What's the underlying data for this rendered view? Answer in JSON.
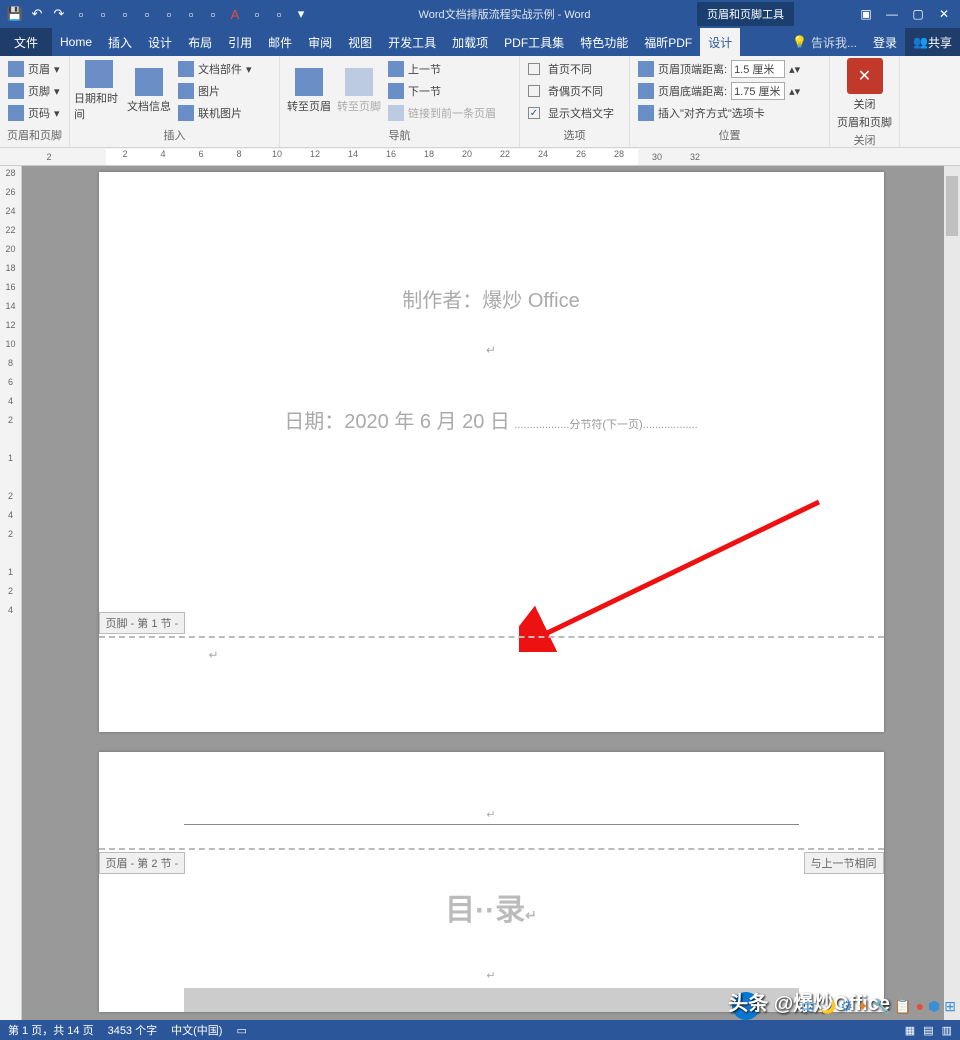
{
  "title": "Word文档排版流程实战示例 - Word",
  "context_tab": "页眉和页脚工具",
  "menu": {
    "file": "文件",
    "home": "Home",
    "insert": "插入",
    "design": "设计",
    "layout": "布局",
    "ref": "引用",
    "mail": "邮件",
    "review": "审阅",
    "view": "视图",
    "dev": "开发工具",
    "addin": "加载项",
    "pdf": "PDF工具集",
    "special": "特色功能",
    "foxit": "福昕PDF",
    "design2": "设计",
    "tell": "告诉我...",
    "login": "登录",
    "share": "共享"
  },
  "ribbon": {
    "header": "页眉",
    "footer": "页脚",
    "pagenum": "页码",
    "datetime": "日期和时间",
    "docinfo": "文档信息",
    "parts": "文档部件",
    "pic": "图片",
    "onlinepic": "联机图片",
    "goheader": "转至页眉",
    "gofooter": "转至页脚",
    "prev": "上一节",
    "next": "下一节",
    "linkprev": "链接到前一条页眉",
    "firstdiff": "首页不同",
    "oddeven": "奇偶页不同",
    "showdoc": "显示文档文字",
    "topdist": "页眉顶端距离:",
    "botdist": "页眉底端距离:",
    "aligntab": "插入\"对齐方式\"选项卡",
    "topval": "1.5 厘米",
    "botval": "1.75 厘米",
    "close": "关闭",
    "closehf": "页眉和页脚",
    "g1": "页眉和页脚",
    "g2": "插入",
    "g3": "导航",
    "g4": "选项",
    "g5": "位置",
    "g6": "关闭"
  },
  "doc": {
    "author": "制作者：爆炒 Office",
    "date": "日期：2020 年 6 月 20 日",
    "sectbreak": "分节符(下一页)",
    "footer1": "页脚 - 第 1 节 -",
    "header2": "页眉 - 第 2 节 -",
    "sameprev": "与上一节相同",
    "toc": "目··录"
  },
  "status": {
    "page": "第 1 页，共 14 页",
    "words": "3453 个字",
    "lang": "中文(中国)"
  },
  "watermark": "头条 @爆炒Office",
  "ruler_h": [
    2,
    "",
    2,
    4,
    6,
    8,
    10,
    12,
    14,
    16,
    18,
    20,
    22,
    24,
    26,
    28,
    30,
    32
  ],
  "ruler_v": [
    28,
    26,
    24,
    22,
    20,
    18,
    16,
    14,
    12,
    10,
    8,
    6,
    4,
    2,
    "",
    1,
    "",
    2,
    4,
    2,
    "",
    1,
    2,
    4
  ]
}
